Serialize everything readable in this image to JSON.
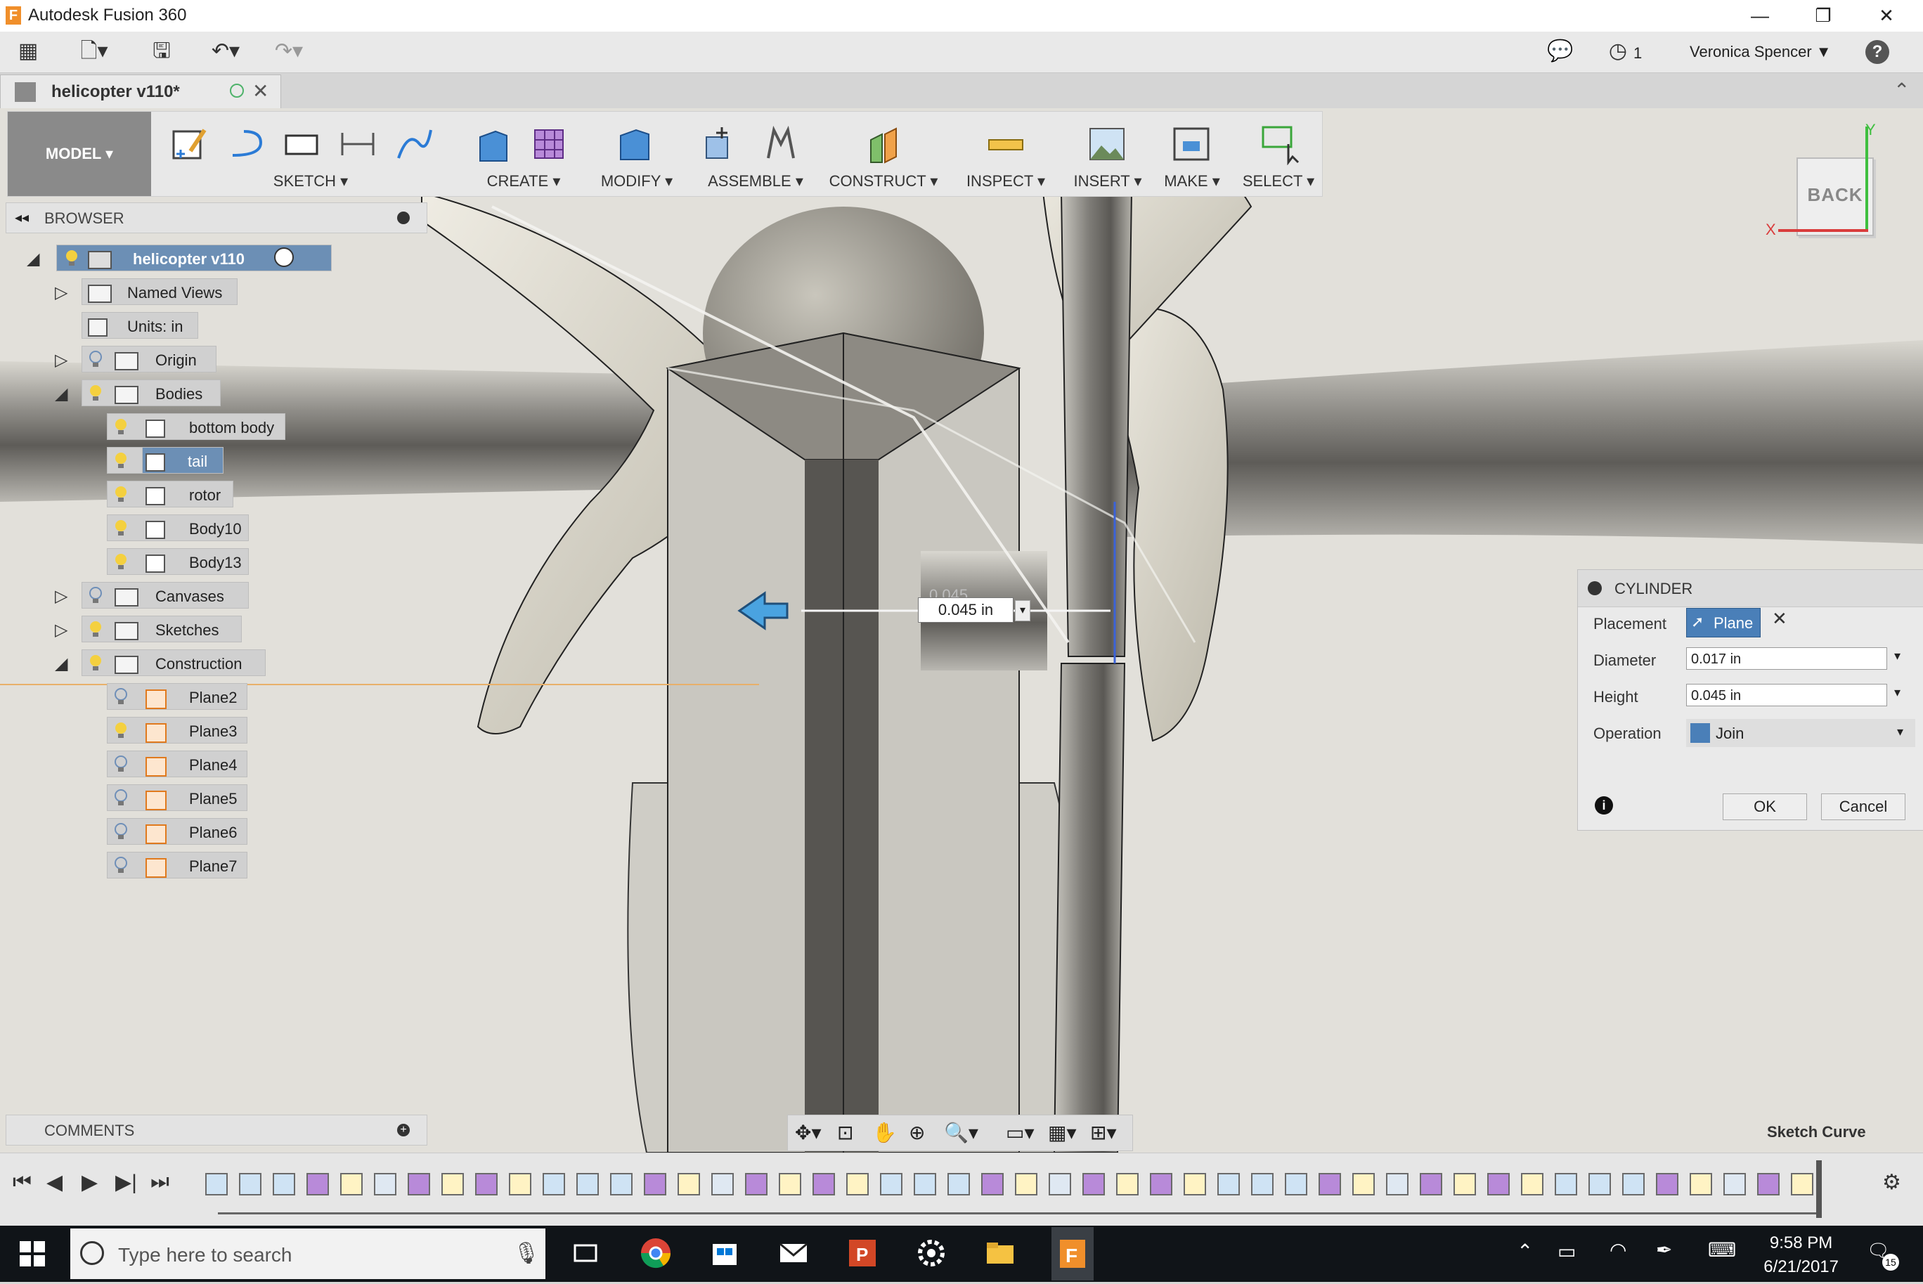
{
  "window": {
    "app_letter": "F",
    "title": "Autodesk Fusion 360",
    "minimize": "—",
    "restore": "❐",
    "close": "✕"
  },
  "quick_access": {
    "notification_count": "1",
    "user": "Veronica Spencer ▼",
    "help": "?"
  },
  "doc_tab": {
    "name": "helicopter v110*"
  },
  "toolbar": {
    "mode": "MODEL ▾",
    "groups": [
      {
        "label": "SKETCH ▾"
      },
      {
        "label": "CREATE ▾"
      },
      {
        "label": "MODIFY ▾"
      },
      {
        "label": "ASSEMBLE ▾"
      },
      {
        "label": "CONSTRUCT ▾"
      },
      {
        "label": "INSPECT ▾"
      },
      {
        "label": "INSERT ▾"
      },
      {
        "label": "MAKE ▾"
      },
      {
        "label": "SELECT ▾"
      }
    ]
  },
  "browser": {
    "title": "BROWSER",
    "root": "helicopter v110",
    "items": [
      {
        "label": "Named Views"
      },
      {
        "label": "Units: in"
      },
      {
        "label": "Origin"
      },
      {
        "label": "Bodies"
      },
      {
        "label": "bottom body"
      },
      {
        "label": "tail"
      },
      {
        "label": "rotor"
      },
      {
        "label": "Body10"
      },
      {
        "label": "Body13"
      },
      {
        "label": "Canvases"
      },
      {
        "label": "Sketches"
      },
      {
        "label": "Construction"
      },
      {
        "label": "Plane2"
      },
      {
        "label": "Plane3"
      },
      {
        "label": "Plane4"
      },
      {
        "label": "Plane5"
      },
      {
        "label": "Plane6"
      },
      {
        "label": "Plane7"
      }
    ]
  },
  "comments": {
    "title": "COMMENTS"
  },
  "viewport": {
    "dimension_value": "0.045 in",
    "dimension_ghost": "0.045",
    "viewcube_face": "BACK",
    "axis_x": "X",
    "axis_y": "Y",
    "status": "Sketch Curve"
  },
  "cylinder": {
    "title": "CYLINDER",
    "placement_label": "Placement",
    "placement_value": "Plane",
    "diameter_label": "Diameter",
    "diameter_value": "0.017 in",
    "height_label": "Height",
    "height_value": "0.045 in",
    "operation_label": "Operation",
    "operation_value": "Join",
    "ok": "OK",
    "cancel": "Cancel"
  },
  "taskbar": {
    "search_placeholder": "Type here to search",
    "time": "9:58 PM",
    "date": "6/21/2017",
    "notifications": "15"
  },
  "colors": {
    "accent_blue": "#4a7fb8",
    "selection": "#6c8fb5",
    "plane_orange": "#e07a1e",
    "taskbar": "#101418"
  }
}
